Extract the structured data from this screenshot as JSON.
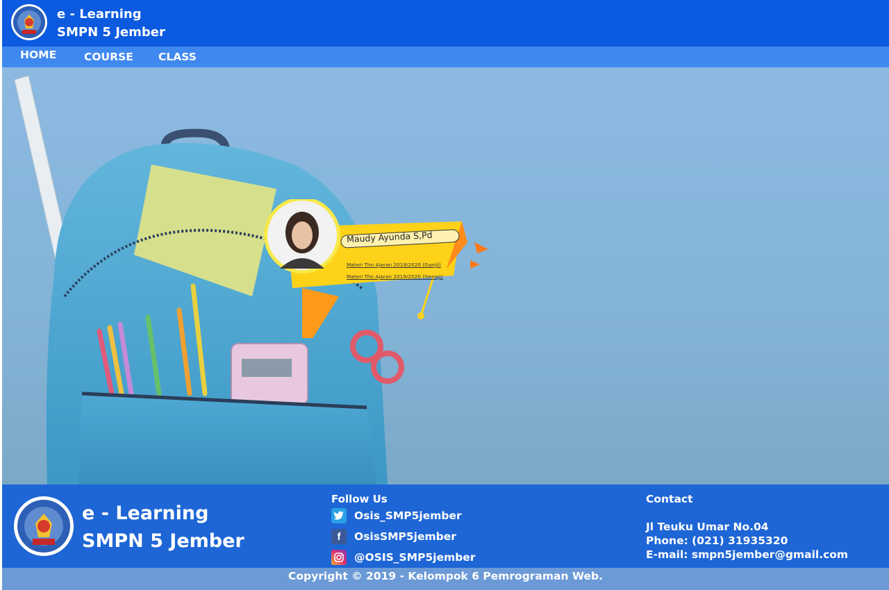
{
  "header": {
    "brand_line1": "e - Learning",
    "brand_line2": "SMPN 5 Jember",
    "logo_icon": "school-emblem-icon"
  },
  "nav": {
    "items": [
      {
        "label": "HOME"
      },
      {
        "label": "COURSE"
      },
      {
        "label": "CLASS"
      }
    ]
  },
  "teacher_card": {
    "name": "Maudy Ayunda S,Pd",
    "links": [
      "Materi Thn Ajaran 2019/2020 (Ganjil)",
      "Materi Thn Ajaran 2019/2020 (Genap)"
    ]
  },
  "footer": {
    "brand_line1": "e - Learning",
    "brand_line2": "SMPN 5 Jember",
    "follow_title": "Follow Us",
    "socials": [
      {
        "icon": "twitter-icon",
        "label": "Osis_SMP5jember"
      },
      {
        "icon": "facebook-icon",
        "label": "OsisSMP5jember"
      },
      {
        "icon": "instagram-icon",
        "label": "@OSIS_SMP5jember"
      }
    ],
    "contact_title": "Contact",
    "contact_lines": [
      "Jl Teuku Umar No.04",
      "Phone: (021) 31935320",
      "E-mail: smpn5jember@gmail.com"
    ],
    "copyright": "Copyright © 2019 - Kelompok 6 Pemrograman Web."
  },
  "colors": {
    "header": "#0b5ae0",
    "nav": "#3f88f0",
    "footer": "#1e66d6",
    "copyright_bar": "#6b9ad6",
    "card_yellow": "#ffd21a"
  }
}
